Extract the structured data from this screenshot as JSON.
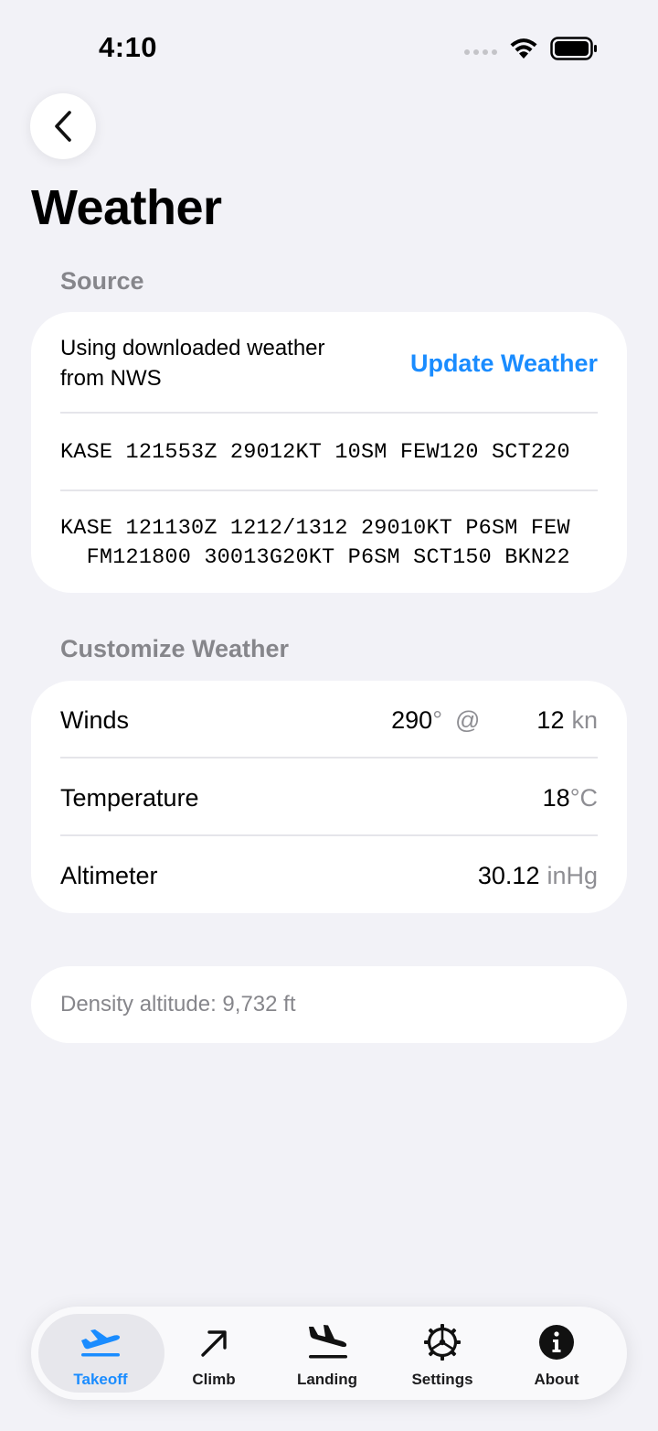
{
  "status": {
    "time": "4:10"
  },
  "header": {
    "title": "Weather"
  },
  "source": {
    "section_title": "Source",
    "description": "Using downloaded weather from NWS",
    "update_button": "Update Weather",
    "metar": "KASE 121553Z 29012KT 10SM FEW120 SCT220",
    "taf_line1": "KASE 121130Z 1212/1312 29010KT P6SM FEW",
    "taf_line2": "  FM121800 30013G20KT P6SM SCT150 BKN22"
  },
  "customize": {
    "section_title": "Customize Weather",
    "winds": {
      "label": "Winds",
      "direction": "290",
      "direction_unit": "°",
      "at": "@",
      "speed": "12",
      "speed_unit": "kn"
    },
    "temperature": {
      "label": "Temperature",
      "value": "18",
      "unit": "°C"
    },
    "altimeter": {
      "label": "Altimeter",
      "value": "30.12",
      "unit": "inHg"
    }
  },
  "density": {
    "text": "Density altitude: 9,732 ft"
  },
  "tabbar": {
    "active_color": "#1a8cff",
    "tabs": [
      {
        "label": "Takeoff",
        "icon": "takeoff-icon",
        "active": true
      },
      {
        "label": "Climb",
        "icon": "climb-arrow-icon",
        "active": false
      },
      {
        "label": "Landing",
        "icon": "landing-icon",
        "active": false
      },
      {
        "label": "Settings",
        "icon": "gear-icon",
        "active": false
      },
      {
        "label": "About",
        "icon": "info-icon",
        "active": false
      }
    ]
  }
}
